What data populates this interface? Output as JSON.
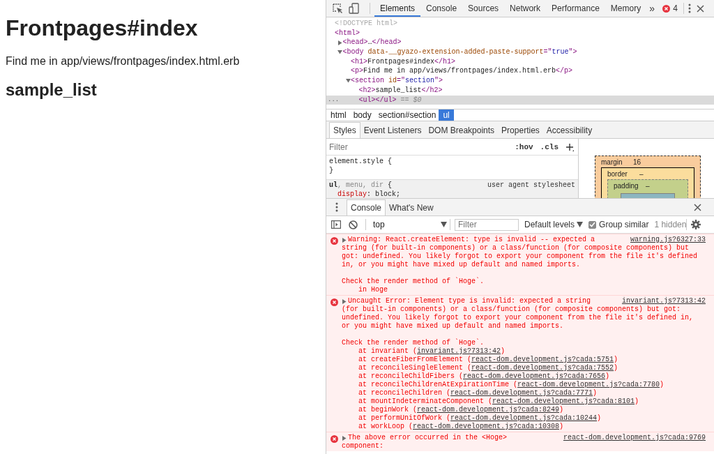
{
  "page": {
    "heading": "Frontpages#index",
    "paragraph": "Find me in app/views/frontpages/index.html.erb",
    "subheading": "sample_list"
  },
  "devtools": {
    "tabs": [
      {
        "label": "Elements",
        "selected": true
      },
      {
        "label": "Console",
        "selected": false
      },
      {
        "label": "Sources",
        "selected": false
      },
      {
        "label": "Network",
        "selected": false
      },
      {
        "label": "Performance",
        "selected": false
      },
      {
        "label": "Memory",
        "selected": false
      }
    ],
    "overflow": "»",
    "error_count": "4",
    "dom_tree": [
      {
        "tokens": [
          {
            "kind": "doctype",
            "text": "<!DOCTYPE html>"
          }
        ]
      },
      {
        "tokens": [
          {
            "kind": "tag",
            "text": "<html>"
          }
        ],
        "children": [
          {
            "expanded": false,
            "tokens": [
              {
                "kind": "tag",
                "text": "<head>"
              },
              {
                "kind": "text",
                "text": "…"
              },
              {
                "kind": "tag",
                "text": "</head>"
              }
            ]
          },
          {
            "expanded": true,
            "tokens": [
              {
                "kind": "tag",
                "text": "<body "
              },
              {
                "kind": "attr",
                "text": "data-__gyazo-extension-added-paste-support"
              },
              {
                "kind": "tag",
                "text": "=\""
              },
              {
                "kind": "value",
                "text": "true"
              },
              {
                "kind": "tag",
                "text": "\">"
              }
            ],
            "children": [
              {
                "tokens": [
                  {
                    "kind": "tag",
                    "text": "<h1>"
                  },
                  {
                    "kind": "text",
                    "text": "Frontpages#index"
                  },
                  {
                    "kind": "tag",
                    "text": "</h1>"
                  }
                ]
              },
              {
                "tokens": [
                  {
                    "kind": "tag",
                    "text": "<p>"
                  },
                  {
                    "kind": "text",
                    "text": "Find me in app/views/frontpages/index.html.erb"
                  },
                  {
                    "kind": "tag",
                    "text": "</p>"
                  }
                ]
              },
              {
                "expanded": true,
                "tokens": [
                  {
                    "kind": "tag",
                    "text": "<section "
                  },
                  {
                    "kind": "attr",
                    "text": "id"
                  },
                  {
                    "kind": "tag",
                    "text": "=\""
                  },
                  {
                    "kind": "value",
                    "text": "section"
                  },
                  {
                    "kind": "tag",
                    "text": "\">"
                  }
                ],
                "children": [
                  {
                    "tokens": [
                      {
                        "kind": "tag",
                        "text": "<h2>"
                      },
                      {
                        "kind": "text",
                        "text": "sample_list"
                      },
                      {
                        "kind": "tag",
                        "text": "</h2>"
                      }
                    ]
                  },
                  {
                    "selected": true,
                    "gutter": "...",
                    "tokens": [
                      {
                        "kind": "tag",
                        "text": "<ul></ul>"
                      },
                      {
                        "kind": "hint",
                        "text": " == "
                      },
                      {
                        "kind": "var",
                        "text": "$0"
                      }
                    ]
                  }
                ]
              }
            ]
          }
        ]
      }
    ],
    "breadcrumbs": [
      {
        "label": "html",
        "selected": false
      },
      {
        "label": "body",
        "selected": false
      },
      {
        "label": "section#section",
        "selected": false
      },
      {
        "label": "ul",
        "selected": true
      }
    ],
    "sidebar_tabs": [
      {
        "label": "Styles",
        "selected": true
      },
      {
        "label": "Event Listeners",
        "selected": false
      },
      {
        "label": "DOM Breakpoints",
        "selected": false
      },
      {
        "label": "Properties",
        "selected": false
      },
      {
        "label": "Accessibility",
        "selected": false
      }
    ],
    "styles": {
      "filter_placeholder": "Filter",
      "hov": ":hov",
      "cls": ".cls",
      "rules": [
        {
          "header": [
            {
              "kind": "selector",
              "text": "element.style"
            },
            {
              "kind": "plain",
              "text": " {"
            }
          ],
          "lines": [
            [
              {
                "kind": "plain",
                "text": "}"
              }
            ]
          ]
        },
        {
          "header": [
            {
              "kind": "selector",
              "text": "ul"
            },
            {
              "kind": "dim",
              "text": ", menu, dir"
            },
            {
              "kind": "plain",
              "text": " {"
            }
          ],
          "source": "user agent stylesheet",
          "lines": [
            [
              {
                "kind": "prop",
                "text": "display"
              },
              {
                "kind": "plain",
                "text": ": block;"
              }
            ]
          ]
        }
      ]
    },
    "box_model": {
      "margin": {
        "label": "margin",
        "value": "16"
      },
      "border": {
        "label": "border",
        "value": "–"
      },
      "padding": {
        "label": "padding",
        "value": "–"
      }
    },
    "drawer": {
      "tabs": [
        {
          "label": "Console",
          "selected": true
        },
        {
          "label": "What's New",
          "selected": false
        }
      ],
      "toolbar": {
        "context": "top",
        "filter_placeholder": "Filter",
        "levels": "Default levels",
        "group_similar": {
          "label": "Group similar",
          "checked": true
        },
        "hidden": "1 hidden"
      },
      "messages": [
        {
          "kind": "error",
          "expanded": false,
          "source": "warning.js?6327:33",
          "head": "Warning: React.createElement: type is invalid -- expected a",
          "text": "string (for built-in components) or a class/function (for composite components) but got: undefined. You likely forgot to export your component from the file it's defined in, or you might have mixed up default and named imports.\n\nCheck the render method of `Hoge`.\n    in Hoge"
        },
        {
          "kind": "error",
          "expanded": false,
          "source": "invariant.js?7313:42",
          "head": "Uncaught Error: Element type is invalid: expected a string",
          "text": "(for built-in components) or a class/function (for composite components) but got: undefined. You likely forgot to export your component from the file it's defined in, or you might have mixed up default and named imports.\n\nCheck the render method of `Hoge`.",
          "stack": [
            {
              "prefix": "at invariant (",
              "link": "invariant.js?7313:42",
              "suffix": ")"
            },
            {
              "prefix": "at createFiberFromElement (",
              "link": "react-dom.development.js?cada:5751",
              "suffix": ")"
            },
            {
              "prefix": "at reconcileSingleElement (",
              "link": "react-dom.development.js?cada:7552",
              "suffix": ")"
            },
            {
              "prefix": "at reconcileChildFibers (",
              "link": "react-dom.development.js?cada:7656",
              "suffix": ")"
            },
            {
              "prefix": "at reconcileChildrenAtExpirationTime (",
              "link": "react-dom.development.js?cada:7780",
              "suffix": ")"
            },
            {
              "prefix": "at reconcileChildren (",
              "link": "react-dom.development.js?cada:7771",
              "suffix": ")"
            },
            {
              "prefix": "at mountIndeterminateComponent (",
              "link": "react-dom.development.js?cada:8101",
              "suffix": ")"
            },
            {
              "prefix": "at beginWork (",
              "link": "react-dom.development.js?cada:8249",
              "suffix": ")"
            },
            {
              "prefix": "at performUnitOfWork (",
              "link": "react-dom.development.js?cada:10244",
              "suffix": ")"
            },
            {
              "prefix": "at workLoop (",
              "link": "react-dom.development.js?cada:10308",
              "suffix": ")"
            }
          ]
        },
        {
          "kind": "error",
          "expanded": false,
          "source": "react-dom.development.js?cada:9769",
          "head": "The above error occurred in the <Hoge>",
          "text": "component:"
        }
      ]
    }
  }
}
